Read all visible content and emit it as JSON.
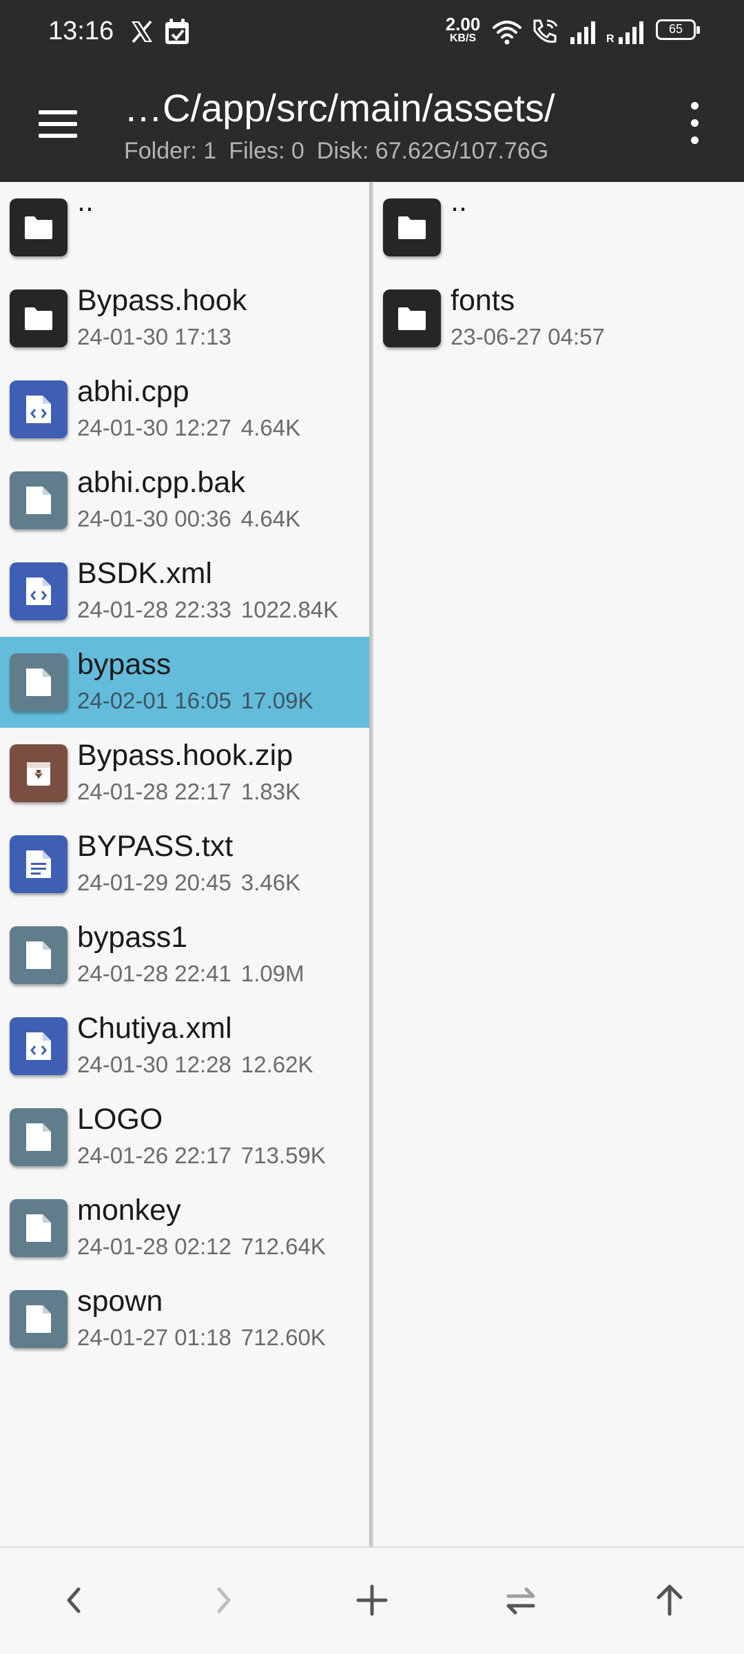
{
  "status_bar": {
    "time": "13:16",
    "net_speed_value": "2.00",
    "net_speed_unit": "KB/S",
    "roaming": "R",
    "battery": "65",
    "icons": [
      "x-icon",
      "calendar-icon",
      "wifi-icon",
      "wifi-call-icon",
      "signal-icon",
      "signal-roaming-icon",
      "battery-icon"
    ]
  },
  "app_bar": {
    "path": "…C/app/src/main/assets/",
    "folder_count": "Folder: 1",
    "file_count": "Files: 0",
    "disk": "Disk: 67.62G/107.76G"
  },
  "left_pane": {
    "items": [
      {
        "name": "..",
        "type": "folder"
      },
      {
        "name": "Bypass.hook",
        "date": "24-01-30 17:13",
        "size": "",
        "type": "folder"
      },
      {
        "name": "abhi.cpp",
        "date": "24-01-30 12:27",
        "size": "4.64K",
        "type": "code"
      },
      {
        "name": "abhi.cpp.bak",
        "date": "24-01-30 00:36",
        "size": "4.64K",
        "type": "plain"
      },
      {
        "name": "BSDK.xml",
        "date": "24-01-28 22:33",
        "size": "1022.84K",
        "type": "code"
      },
      {
        "name": "bypass",
        "date": "24-02-01 16:05",
        "size": "17.09K",
        "type": "plain",
        "selected": true
      },
      {
        "name": "Bypass.hook.zip",
        "date": "24-01-28 22:17",
        "size": "1.83K",
        "type": "archive"
      },
      {
        "name": "BYPASS.txt",
        "date": "24-01-29 20:45",
        "size": "3.46K",
        "type": "text"
      },
      {
        "name": "bypass1",
        "date": "24-01-28 22:41",
        "size": "1.09M",
        "type": "plain"
      },
      {
        "name": "Chutiya.xml",
        "date": "24-01-30 12:28",
        "size": "12.62K",
        "type": "code"
      },
      {
        "name": "LOGO",
        "date": "24-01-26 22:17",
        "size": "713.59K",
        "type": "plain"
      },
      {
        "name": "monkey",
        "date": "24-01-28 02:12",
        "size": "712.64K",
        "type": "plain"
      },
      {
        "name": "spown",
        "date": "24-01-27 01:18",
        "size": "712.60K",
        "type": "plain"
      }
    ]
  },
  "right_pane": {
    "items": [
      {
        "name": "..",
        "type": "folder"
      },
      {
        "name": "fonts",
        "date": "23-06-27 04:57",
        "size": "",
        "type": "folder"
      }
    ]
  },
  "bottom_bar": {
    "buttons": [
      "back-icon",
      "forward-icon",
      "add-icon",
      "swap-panes-icon",
      "up-directory-icon"
    ]
  },
  "colors": {
    "bar_background": "#2b2b2b",
    "selection": "#64bcdc",
    "folder_icon": "#262626",
    "code_icon": "#3e5fb4",
    "plain_icon": "#607d8b",
    "archive_icon": "#7a4f42"
  }
}
